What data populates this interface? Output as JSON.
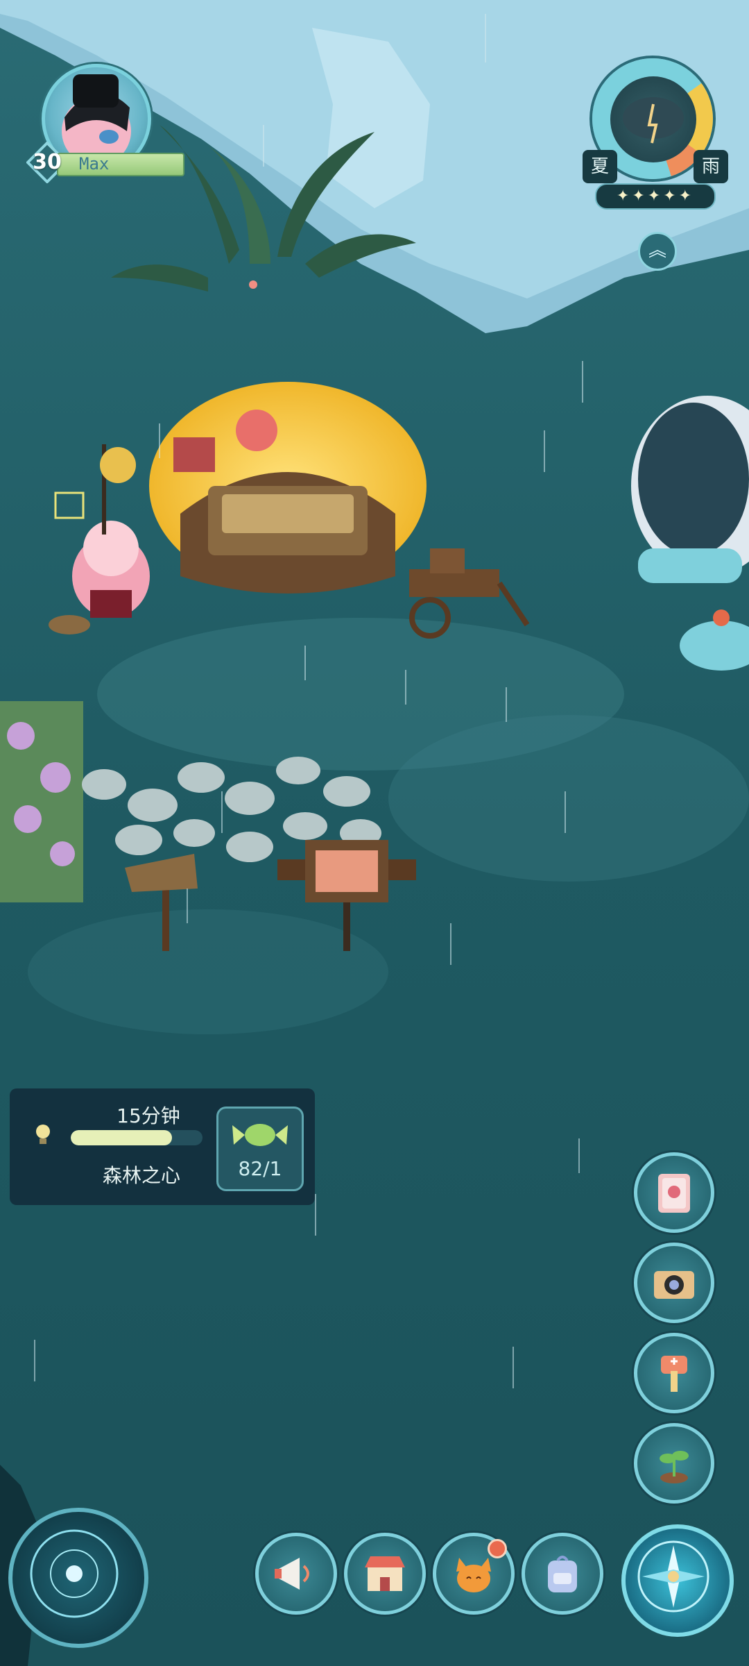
{
  "player": {
    "level": "30",
    "name": "Max"
  },
  "weather": {
    "season": "夏",
    "condition": "雨",
    "stars": "✦✦✦✦✦"
  },
  "task": {
    "time_left": "15分钟",
    "title": "森林之心",
    "progress": 0.77,
    "reward_count": "82/1"
  },
  "icons": {
    "side_tools": [
      "book-icon",
      "camera-icon",
      "hammer-icon",
      "sprout-icon"
    ],
    "bottom_bar": [
      "megaphone-icon",
      "shop-icon",
      "fox-icon",
      "backpack-icon"
    ]
  },
  "colors": {
    "water": "#1f5a63",
    "accent": "#7fd0dc",
    "notification": "#e96a4e"
  }
}
